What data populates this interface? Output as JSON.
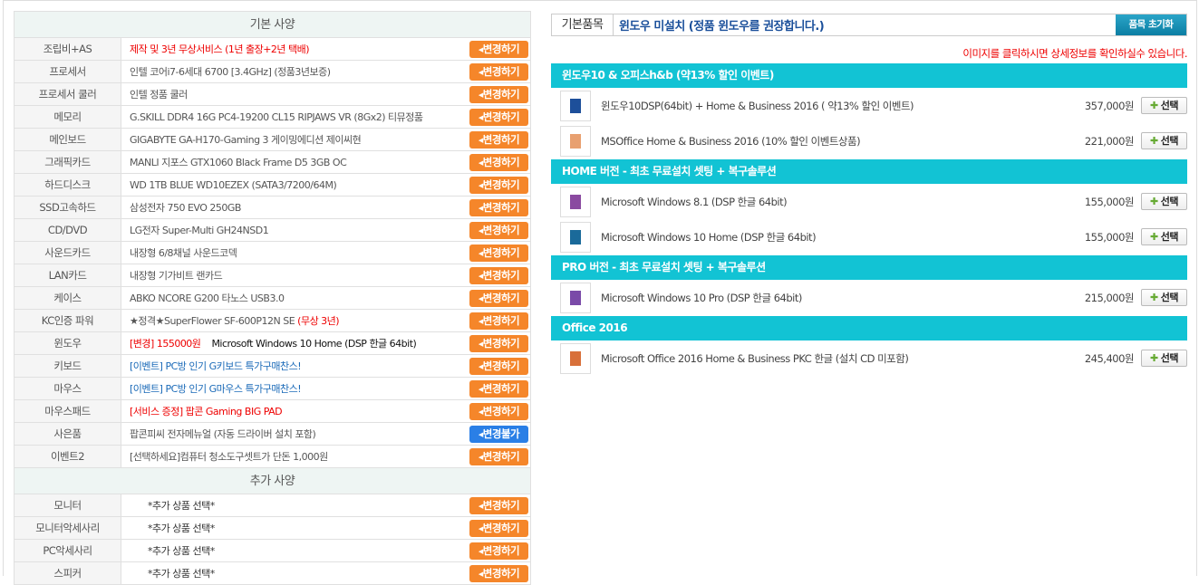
{
  "basic": {
    "title": "기본 사양",
    "rows": [
      {
        "label": "조립비+AS",
        "value": "제작 및 3년 무상서비스 (1년 출장+2년 택배)",
        "style": "red",
        "button": "변경하기"
      },
      {
        "label": "프로세서",
        "value": "인텔 코어i7-6세대 6700 [3.4GHz] (정품3년보증)",
        "button": "변경하기"
      },
      {
        "label": "프로세서 쿨러",
        "value": "인텔 정품 쿨러",
        "button": "변경하기"
      },
      {
        "label": "메모리",
        "value": "G.SKILL DDR4 16G PC4-19200 CL15 RIPJAWS VR (8Gx2) 티뮤정품",
        "button": "변경하기"
      },
      {
        "label": "메인보드",
        "value": "GIGABYTE GA-H170-Gaming 3 게이밍에디션 제이씨현",
        "button": "변경하기"
      },
      {
        "label": "그래픽카드",
        "value": "MANLI 지포스 GTX1060 Black Frame D5 3GB OC",
        "button": "변경하기"
      },
      {
        "label": "하드디스크",
        "value": "WD 1TB BLUE WD10EZEX (SATA3/7200/64M)",
        "button": "변경하기"
      },
      {
        "label": "SSD고속하드",
        "value": "삼성전자 750 EVO 250GB",
        "button": "변경하기"
      },
      {
        "label": "CD/DVD",
        "value": "LG전자 Super-Multi GH24NSD1",
        "button": "변경하기"
      },
      {
        "label": "사운드카드",
        "value": "내장형 6/8채널 사운드코덱",
        "button": "변경하기"
      },
      {
        "label": "LAN카드",
        "value": "내장형 기가비트 랜카드",
        "button": "변경하기"
      },
      {
        "label": "케이스",
        "value": "ABKO NCORE G200 타노스 USB3.0",
        "button": "변경하기"
      },
      {
        "label": "KC인증 파워",
        "value": "★정격★SuperFlower SF-600P12N SE",
        "value2": "(무상 3년)",
        "style2": "red",
        "button": "변경하기"
      },
      {
        "label": "윈도우",
        "value": "[변경] 155000원",
        "style": "red",
        "value2": "Microsoft Windows 10 Home (DSP 한글 64bit)",
        "style2": "dark",
        "button": "변경하기"
      },
      {
        "label": "키보드",
        "value": "[이벤트] PC방 인기 G키보드 특가구매찬스!",
        "style": "blue-t",
        "button": "변경하기"
      },
      {
        "label": "마우스",
        "value": "[이벤트] PC방 인기 G마우스 특가구매찬스!",
        "style": "blue-t",
        "button": "변경하기"
      },
      {
        "label": "마우스패드",
        "value": "[서비스 증정] 팝콘 Gaming BIG PAD",
        "style": "red",
        "button": "변경하기"
      },
      {
        "label": "사은품",
        "value": "팝콘피씨 전자메뉴얼 (자동 드라이버 설치 포함)",
        "button": "변경불가",
        "disabled": true
      },
      {
        "label": "이벤트2",
        "value": "[선택하세요]컴퓨터 청소도구셋트가 단돈 1,000원",
        "button": "변경하기"
      }
    ]
  },
  "extra": {
    "title": "추가 사양",
    "rows": [
      {
        "label": "모니터",
        "value": "*추가 상품 선택*",
        "button": "변경하기"
      },
      {
        "label": "모니터악세사리",
        "value": "*추가 상품 선택*",
        "button": "변경하기"
      },
      {
        "label": "PC악세사리",
        "value": "*추가 상품 선택*",
        "button": "변경하기"
      },
      {
        "label": "스피커",
        "value": "*추가 상품 선택*",
        "button": "변경하기"
      }
    ]
  },
  "right": {
    "base_label": "기본품목",
    "base_value": "윈도우 미설치 (정품 윈도우를 권장합니다.)",
    "reset_button": "품목 초기화",
    "notice_prefix": "이미지를 클릭하시면 ",
    "notice_hl": "상세정보",
    "notice_suffix": "를 확인하실수 있습니다.",
    "select_label": "선택",
    "categories": [
      {
        "title": "윈도우10 & 오피스h&b (약13% 할인 이벤트)",
        "items": [
          {
            "name": "윈도우10DSP(64bit) + Home & Business 2016 ( 약13% 할인 이벤트)",
            "price": "357,000원",
            "color": "#1d4f9a"
          },
          {
            "name": "MSOffice Home & Business 2016 (10% 할인 이벤트상품)",
            "price": "221,000원",
            "color": "#e8a070"
          }
        ]
      },
      {
        "title": "HOME 버전 - 최초 무료설치 셋팅 + 복구솔루션",
        "items": [
          {
            "name": "Microsoft Windows 8.1 (DSP 한글 64bit)",
            "price": "155,000원",
            "color": "#8a4aa0"
          },
          {
            "name": "Microsoft Windows 10 Home (DSP 한글 64bit)",
            "price": "155,000원",
            "color": "#1a6a9a"
          }
        ]
      },
      {
        "title": "PRO 버전 - 최초 무료설치 셋팅 + 복구솔루션",
        "items": [
          {
            "name": "Microsoft Windows 10 Pro (DSP 한글 64bit)",
            "price": "215,000원",
            "color": "#7a4aa8"
          }
        ]
      },
      {
        "title": "Office 2016",
        "items": [
          {
            "name": "Microsoft Office 2016 Home & Business PKC 한글 (설치 CD 미포함)",
            "price": "245,400원",
            "color": "#d8703a"
          }
        ]
      }
    ]
  }
}
